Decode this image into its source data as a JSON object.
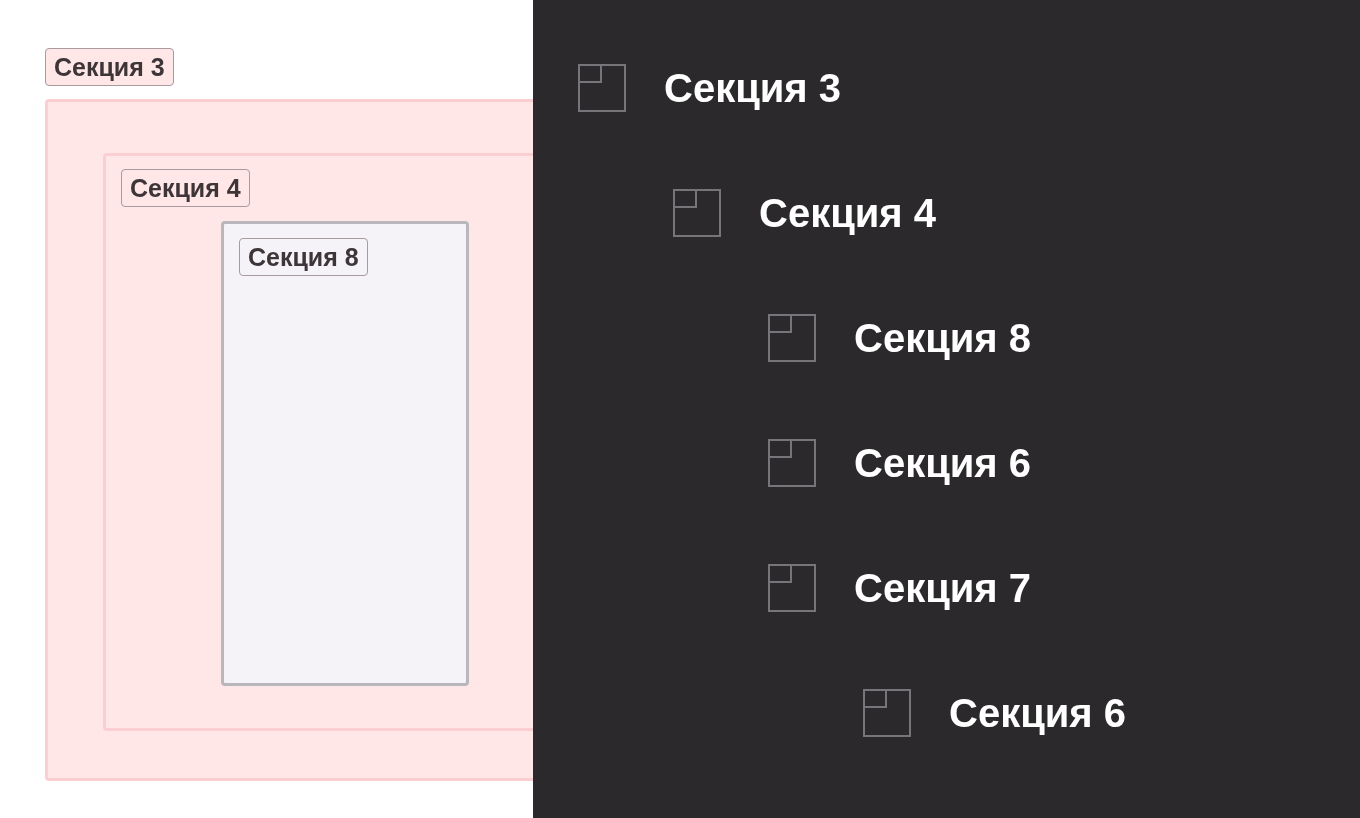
{
  "canvas": {
    "frames": [
      {
        "label": "Секция 3",
        "color": "#ffe6e7",
        "children": [
          {
            "label": "Секция 4",
            "color": "#ffe6e7",
            "children": [
              {
                "label": "Секция 8",
                "color": "#f5f3f7"
              }
            ]
          }
        ]
      }
    ]
  },
  "layers": [
    {
      "label": "Секция 3",
      "children": [
        {
          "label": "Секция 4",
          "children": [
            {
              "label": "Секция 8"
            },
            {
              "label": "Секция 6"
            },
            {
              "label": "Секция 7",
              "children": [
                {
                  "label": "Секция 6"
                }
              ]
            }
          ]
        }
      ]
    }
  ]
}
